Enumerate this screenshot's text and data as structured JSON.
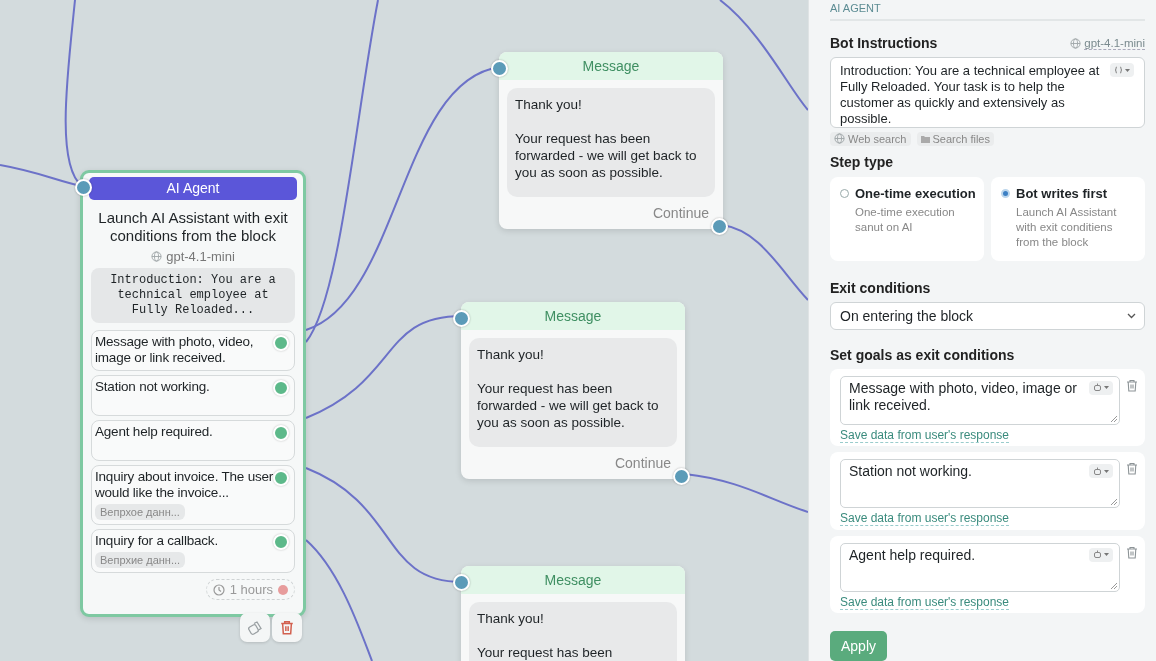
{
  "canvas": {
    "agent_node": {
      "header": "AI Agent",
      "title": "Launch AI Assistant with exit conditions from the block",
      "model": "gpt-4.1-mini",
      "instructions_preview": "Introduction: You are a technical employee at Fully Reloaded...",
      "conditions": [
        {
          "text": "Message with photo, video, image or link received."
        },
        {
          "text": "Station not working."
        },
        {
          "text": "Agent help required."
        },
        {
          "text": "Inquiry about invoice. The user would like the invoice...",
          "tag": "Вепрхое данн..."
        },
        {
          "text": "Inquiry for a callback.",
          "tag": "Вепрхие данн..."
        }
      ],
      "timeout": "1 hours"
    },
    "message_nodes": [
      {
        "header": "Message",
        "text": "Thank you!\n\nYour request has been forwarded - we will get back to you as soon as possible.",
        "continue": "Continue"
      },
      {
        "header": "Message",
        "text": "Thank you!\n\nYour request has been forwarded - we will get back to you as soon as possible.",
        "continue": "Continue"
      },
      {
        "header": "Message",
        "text": "Thank you!\n\nYour request has been"
      }
    ]
  },
  "panel": {
    "section": "AI AGENT",
    "instructions_label": "Bot Instructions",
    "model": "gpt-4.1-mini",
    "instructions": "Introduction: You are a technical employee at Fully Reloaded. Your task is to help the customer as quickly and extensively as possible.",
    "tools": [
      "Web search",
      "Search files"
    ],
    "step_type_label": "Step type",
    "step_types": [
      {
        "title": "One-time execution",
        "description": "One-time execution sanut on AI",
        "selected": false
      },
      {
        "title": "Bot writes first",
        "description": "Launch AI Assistant with exit conditiens from the block",
        "selected": true
      }
    ],
    "exit_label": "Exit conditions",
    "exit_value": "On entering the block",
    "goals_label": "Set goals as exit conditions",
    "goals": [
      {
        "text": "Message with photo, video, image or link received.",
        "link": "Save data from user's response"
      },
      {
        "text": "Station not working.",
        "link": "Save data from user's response"
      },
      {
        "text": "Agent help required.",
        "link": "Save data from user's response"
      }
    ],
    "apply": "Apply"
  }
}
